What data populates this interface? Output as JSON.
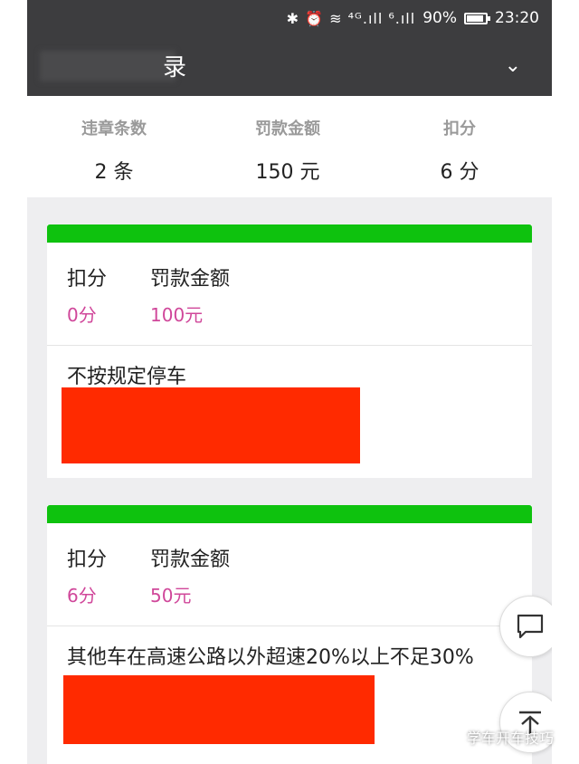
{
  "status_bar": {
    "icons": "✱ ⏰ ≋ ⁴ᴳ.ıll ⁶.ıll",
    "battery": "90%",
    "battery_level": 0.9,
    "time": "23:20"
  },
  "header": {
    "title_visible": "录",
    "more_icon": "chevron-down-icon"
  },
  "summary": {
    "violations_label": "违章条数",
    "violations_value": "2 条",
    "fine_label": "罚款金额",
    "fine_value": "150 元",
    "points_label": "扣分",
    "points_value": "6 分"
  },
  "records": [
    {
      "points_label": "扣分",
      "points_value": "0分",
      "fine_label": "罚款金额",
      "fine_value": "100元",
      "description": "不按规定停车"
    },
    {
      "points_label": "扣分",
      "points_value": "6分",
      "fine_label": "罚款金额",
      "fine_value": "50元",
      "description": "其他车在高速公路以外超速20%以上不足30%"
    }
  ],
  "floating": {
    "comment_icon": "comment-icon",
    "top_icon": "back-to-top-icon"
  },
  "watermark": {
    "text": "学车开车技巧"
  },
  "colors": {
    "bar_green": "#0ec20e",
    "value_pink": "#d0479a",
    "redact_red": "#ff2a00",
    "header_dark": "#3d3d3f"
  }
}
